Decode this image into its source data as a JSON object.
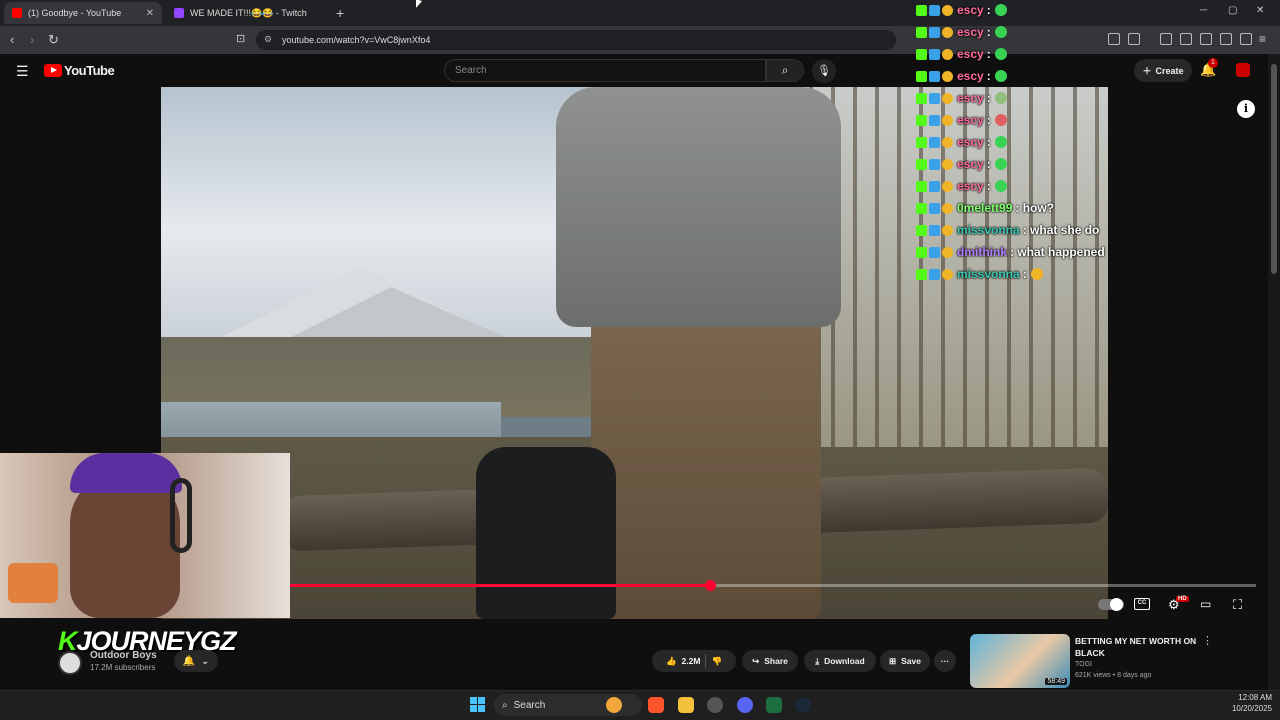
{
  "browser": {
    "tabs": [
      {
        "title": "(1) Goodbye - YouTube",
        "close": "✕"
      },
      {
        "title": "WE MADE IT!!!😂😂 - Twitch"
      }
    ],
    "new_tab": "+",
    "window_controls": [
      "─",
      "▢",
      "✕"
    ],
    "url": "youtube.com/watch?v=VwC8jwnXfo4"
  },
  "youtube": {
    "logo_text": "YouTube",
    "search_placeholder": "Search",
    "create_label": "Create",
    "notification_count": "1"
  },
  "player": {
    "progress_fraction": 0.435,
    "accent_color": "#ff0033",
    "info_label": "i",
    "cc_label": "CC",
    "hd_label": "HD"
  },
  "chat": [
    {
      "name": "escy",
      "color": "#ff6b9d",
      "msg": "",
      "emote": "#39d353"
    },
    {
      "name": "escy",
      "color": "#ff6b9d",
      "msg": "",
      "emote": "#39d353"
    },
    {
      "name": "escy",
      "color": "#ff6b9d",
      "msg": "",
      "emote": "#39d353"
    },
    {
      "name": "escy",
      "color": "#ff6b9d",
      "msg": "",
      "emote": "#39d353"
    },
    {
      "name": "escy",
      "color": "#ff6b9d",
      "msg": "",
      "emote": "#8fbf7a"
    },
    {
      "name": "escy",
      "color": "#ff6b9d",
      "msg": "",
      "emote": "#e06060"
    },
    {
      "name": "escy",
      "color": "#ff6b9d",
      "msg": "",
      "emote": "#39d353"
    },
    {
      "name": "escy",
      "color": "#ff6b9d",
      "msg": "",
      "emote": "#39d353"
    },
    {
      "name": "escy",
      "color": "#ff6b9d",
      "msg": "",
      "emote": "#39d353"
    },
    {
      "name": "0melett99",
      "color": "#7dff6b",
      "msg": ": how?",
      "emote": ""
    },
    {
      "name": "missvonna",
      "color": "#39c6b0",
      "msg": ": what she do",
      "emote": ""
    },
    {
      "name": "dmithink",
      "color": "#b07cff",
      "msg": ": what happened",
      "emote": ""
    },
    {
      "name": "missvonna",
      "color": "#39c6b0",
      "msg": ":",
      "emote": "#f0b429"
    }
  ],
  "channel": {
    "overlay_k": "K",
    "overlay_name": "JOURNEYGZ",
    "name": "Outdoor Boys",
    "subscribers": "17.2M subscribers"
  },
  "actions": {
    "likes": "2.2M",
    "share": "Share",
    "download": "Download",
    "save": "Save",
    "more": "···"
  },
  "recommended": {
    "title": "BETTING MY NET WORTH ON BLACK",
    "channel": "TOGI",
    "meta": "621K views • 8 days ago",
    "duration": "58:49"
  },
  "taskbar": {
    "search_label": "Search",
    "time": "12:08 AM",
    "date": "10/20/2025"
  }
}
